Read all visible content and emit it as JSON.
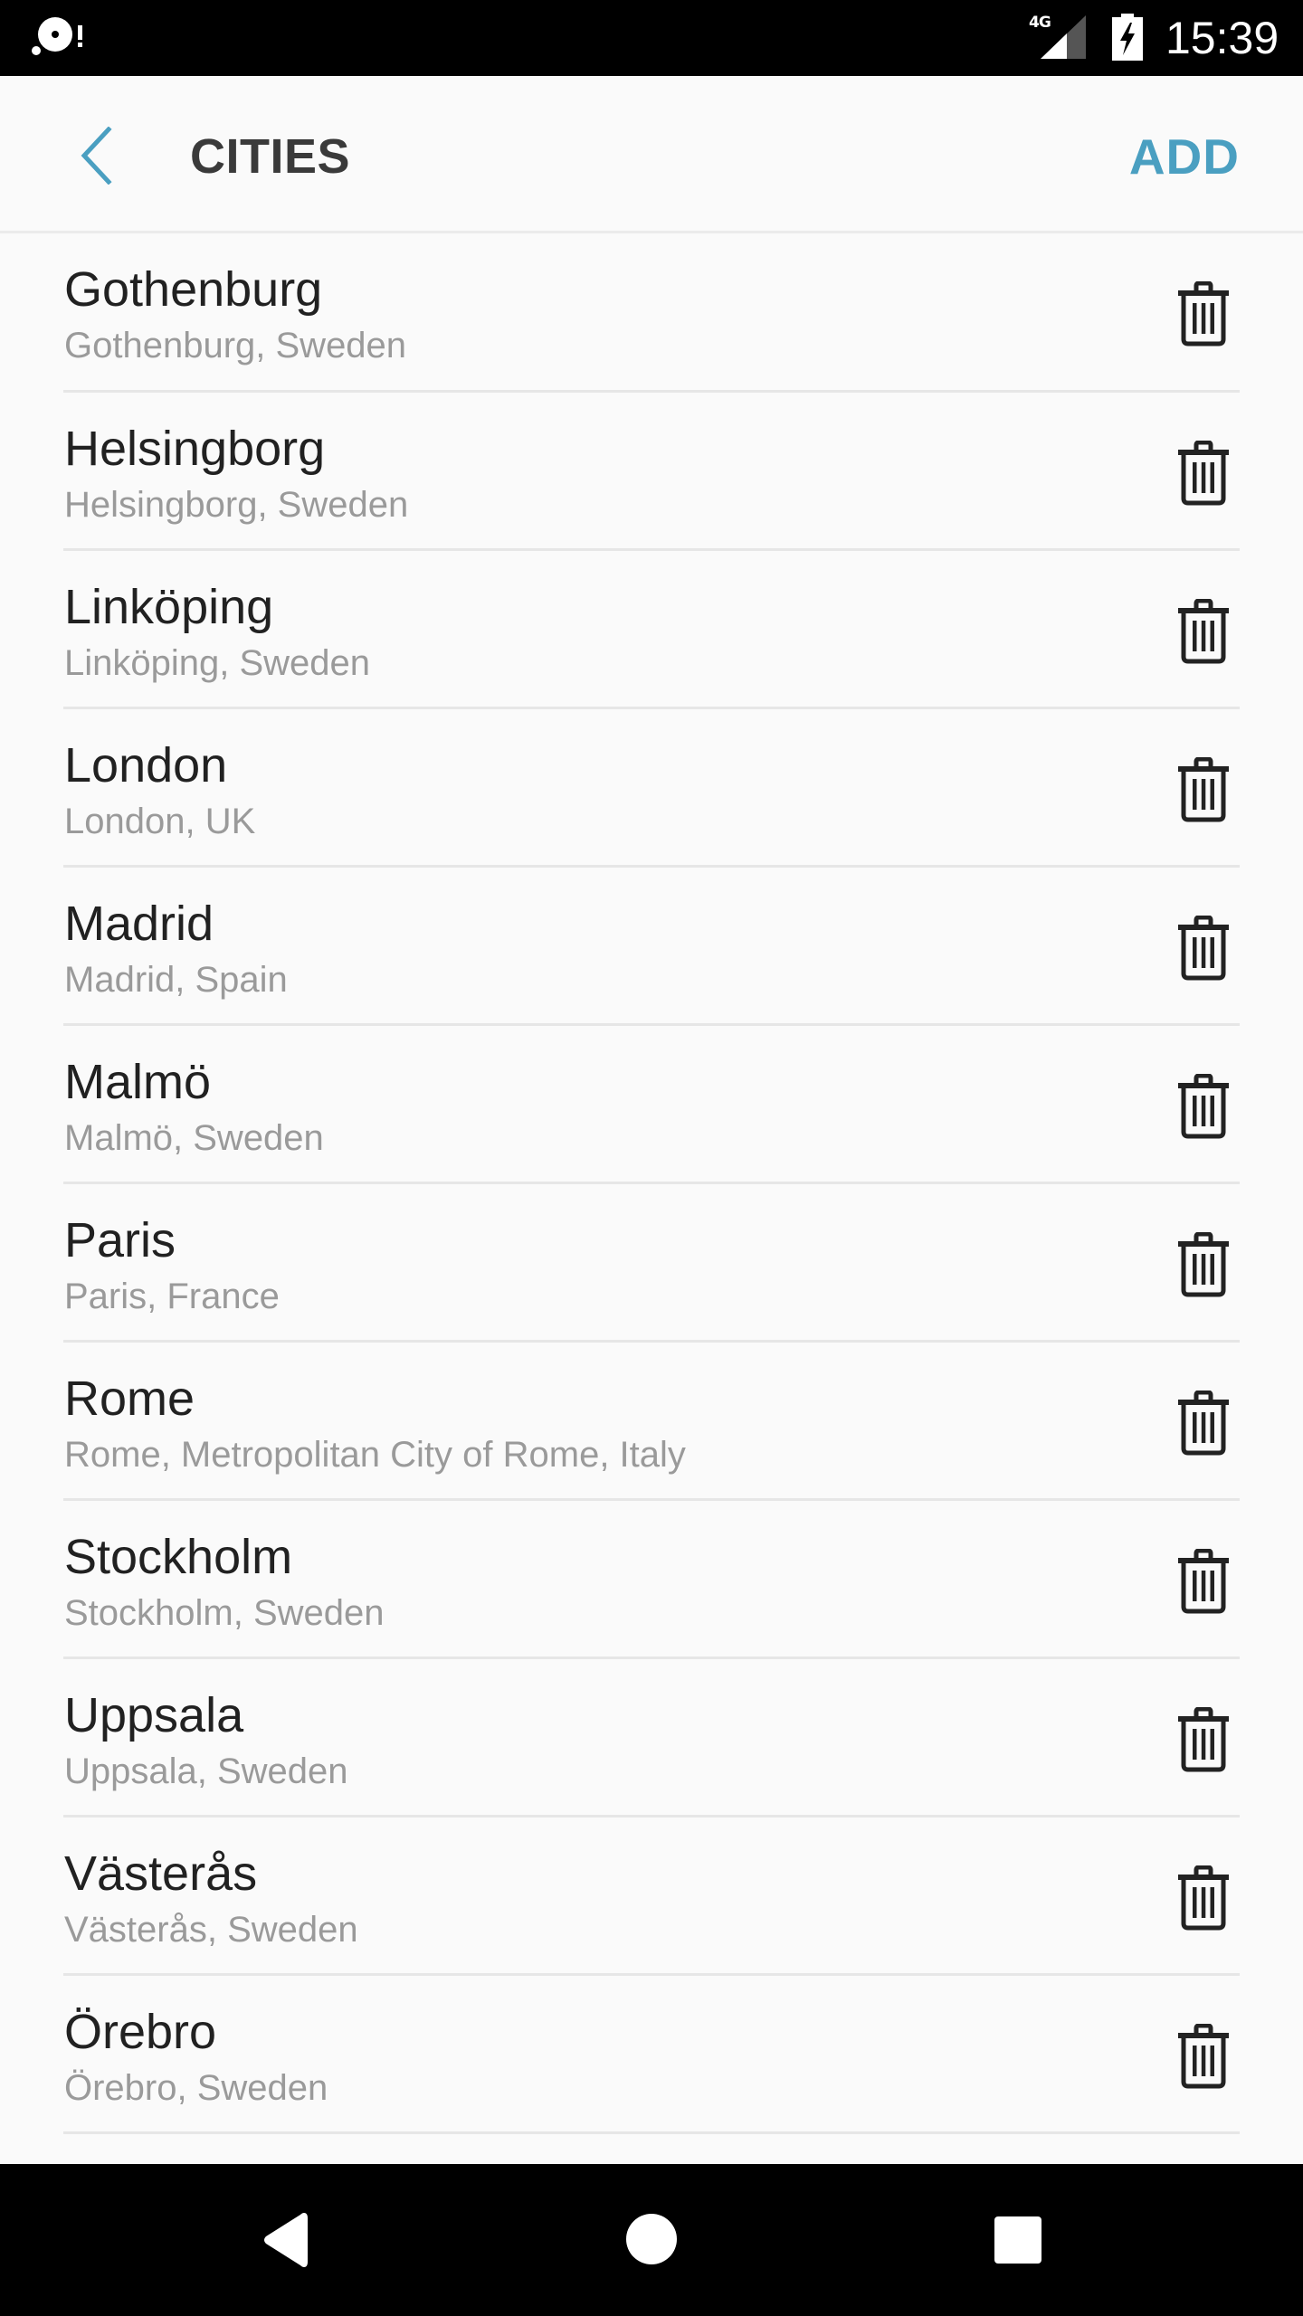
{
  "status_bar": {
    "notification_icon": "storage-alert-icon",
    "network_label": "4G",
    "signal_icon": "cell-signal-icon",
    "battery_icon": "battery-charging-icon",
    "time": "15:39"
  },
  "header": {
    "back_icon": "chevron-left-icon",
    "title": "CITIES",
    "add_label": "ADD",
    "accent_color": "#4a9fc1"
  },
  "cities": [
    {
      "name": "Gothenburg",
      "detail": "Gothenburg, Sweden"
    },
    {
      "name": "Helsingborg",
      "detail": "Helsingborg, Sweden"
    },
    {
      "name": "Linköping",
      "detail": "Linköping, Sweden"
    },
    {
      "name": "London",
      "detail": "London, UK"
    },
    {
      "name": "Madrid",
      "detail": "Madrid, Spain"
    },
    {
      "name": "Malmö",
      "detail": "Malmö, Sweden"
    },
    {
      "name": "Paris",
      "detail": "Paris, France"
    },
    {
      "name": "Rome",
      "detail": "Rome, Metropolitan City of Rome, Italy"
    },
    {
      "name": "Stockholm",
      "detail": "Stockholm, Sweden"
    },
    {
      "name": "Uppsala",
      "detail": "Uppsala, Sweden"
    },
    {
      "name": "Västerås",
      "detail": "Västerås, Sweden"
    },
    {
      "name": "Örebro",
      "detail": "Örebro, Sweden"
    }
  ],
  "row_action_icon": "trash-icon",
  "nav_bar": {
    "back_icon": "nav-back-triangle-icon",
    "home_icon": "nav-home-circle-icon",
    "recents_icon": "nav-recents-square-icon"
  }
}
